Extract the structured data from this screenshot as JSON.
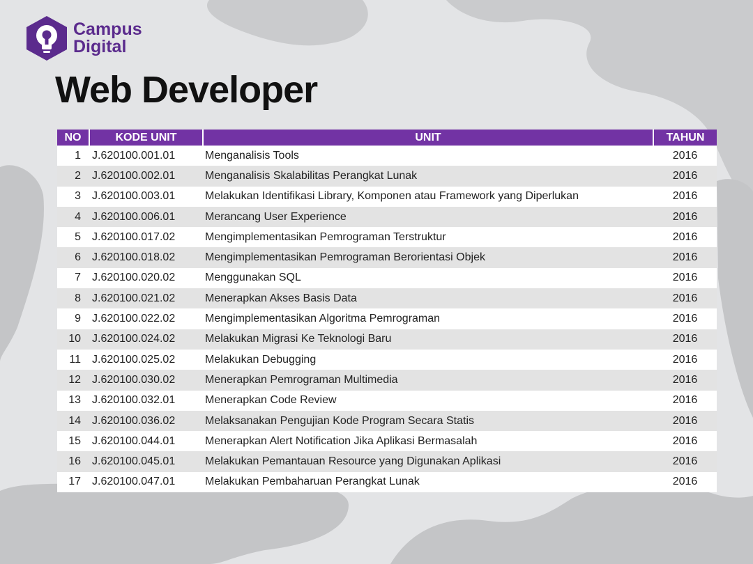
{
  "brand": {
    "name_line1": "Campus",
    "name_line2": "Digital",
    "color": "#5b2b8d"
  },
  "title": "Web Developer",
  "table": {
    "header_color": "#7233a4",
    "headers": [
      "NO",
      "KODE UNIT",
      "UNIT",
      "TAHUN"
    ],
    "rows": [
      [
        "1",
        "J.620100.001.01",
        "Menganalisis Tools",
        "2016"
      ],
      [
        "2",
        "J.620100.002.01",
        "Menganalisis Skalabilitas Perangkat Lunak",
        "2016"
      ],
      [
        "3",
        "J.620100.003.01",
        "Melakukan Identifikasi Library, Komponen atau Framework yang Diperlukan",
        "2016"
      ],
      [
        "4",
        "J.620100.006.01",
        "Merancang User Experience",
        "2016"
      ],
      [
        "5",
        "J.620100.017.02",
        "Mengimplementasikan Pemrograman Terstruktur",
        "2016"
      ],
      [
        "6",
        "J.620100.018.02",
        "Mengimplementasikan Pemrograman Berorientasi Objek",
        "2016"
      ],
      [
        "7",
        "J.620100.020.02",
        "Menggunakan SQL",
        "2016"
      ],
      [
        "8",
        "J.620100.021.02",
        "Menerapkan Akses Basis Data",
        "2016"
      ],
      [
        "9",
        "J.620100.022.02",
        "Mengimplementasikan Algoritma Pemrograman",
        "2016"
      ],
      [
        "10",
        "J.620100.024.02",
        "Melakukan Migrasi Ke Teknologi Baru",
        "2016"
      ],
      [
        "11",
        "J.620100.025.02",
        "Melakukan Debugging",
        "2016"
      ],
      [
        "12",
        "J.620100.030.02",
        "Menerapkan Pemrograman Multimedia",
        "2016"
      ],
      [
        "13",
        "J.620100.032.01",
        "Menerapkan Code Review",
        "2016"
      ],
      [
        "14",
        "J.620100.036.02",
        "Melaksanakan Pengujian Kode Program Secara Statis",
        "2016"
      ],
      [
        "15",
        "J.620100.044.01",
        "Menerapkan Alert Notification Jika Aplikasi Bermasalah",
        "2016"
      ],
      [
        "16",
        "J.620100.045.01",
        "Melakukan Pemantauan Resource yang Digunakan Aplikasi",
        "2016"
      ],
      [
        "17",
        "J.620100.047.01",
        "Melakukan Pembaharuan Perangkat Lunak",
        "2016"
      ]
    ]
  }
}
